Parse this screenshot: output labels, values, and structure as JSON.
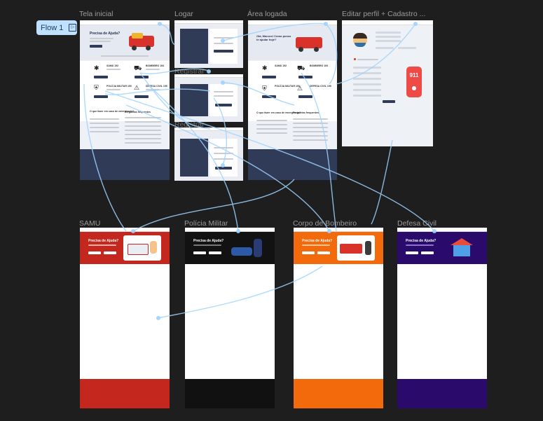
{
  "flow": {
    "label": "Flow 1",
    "icon": "flow-play-icon"
  },
  "frames": {
    "tela_inicial": "Tela inicial",
    "logar": "Logar",
    "registrar_1": "Registrar",
    "registrar_2": "Registrar",
    "area_logada": "Área logada",
    "editar_perfil": "Editar perfil + Cadastro ...",
    "samu": "SAMU",
    "policia_militar": "Polícia Militar",
    "corpo_bombeiros": "Corpo de Bombeiro",
    "defesa_civil": "Defesa Civil"
  },
  "screens": {
    "home_hero": "Precisa de Ajuda?",
    "logged_hero": "Olá, Marcos! Como posso te ajudar hoje?",
    "faq": "Perguntas frequentes",
    "emergency_q": "O que fazer em caso de emergência?",
    "service_hero": "Precisa de Ajuda?",
    "samu_card": "SAMU 192",
    "bombeiros_card": "BOMBEIRO 193",
    "policia_card": "POLÍCIA MILITAR 190",
    "defesa_card": "DEFESA CIVIL 199",
    "phone_number": "911"
  },
  "colors": {
    "canvas": "#1e1e1e",
    "flow_line": "#9fd3ff",
    "navy": "#2f3b57",
    "samu": "#c4271d",
    "policia": "#121212",
    "bombeiros": "#f26a0b",
    "defesa": "#2a0a6b"
  }
}
